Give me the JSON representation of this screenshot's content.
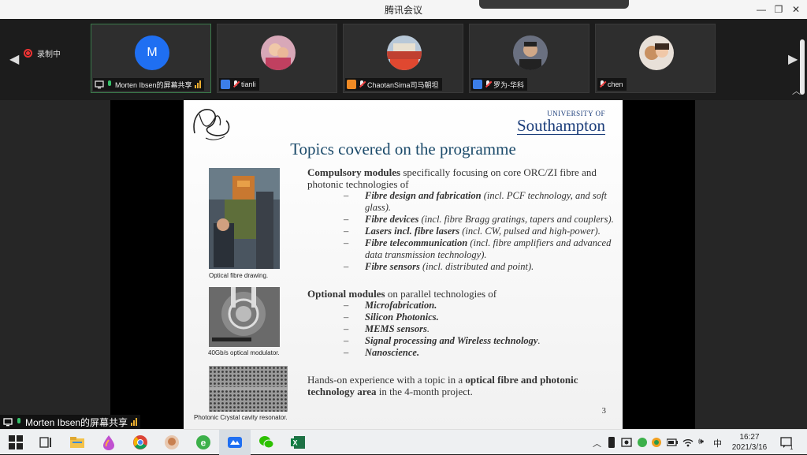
{
  "window": {
    "title": "腾讯会议"
  },
  "recording": {
    "label": "录制中"
  },
  "participants": [
    {
      "initial": "M",
      "name": "Morten Ibsen的屏幕共享",
      "active": true
    },
    {
      "name": "tianli"
    },
    {
      "name": "ChaotanSima司马朝坦"
    },
    {
      "name": "罗为-华科"
    },
    {
      "name": "chen"
    }
  ],
  "slide": {
    "university_small": "UNIVERSITY OF",
    "university_big": "Southampton",
    "title": "Topics covered on the programme",
    "captions": {
      "drawing": "Optical fibre drawing.",
      "modulator": "40Gb/s optical modulator.",
      "crystal": "Photonic Crystal cavity resonator."
    },
    "compulsory": {
      "lead_bold": "Compulsory modules",
      "lead_rest": " specifically focusing on core ORC/ZI fibre and photonic technologies of",
      "items": [
        {
          "bold": "Fibre design and fabrication",
          "rest": " (incl. PCF technology, and soft glass)."
        },
        {
          "bold": "Fibre devices",
          "rest": " (incl. fibre Bragg gratings, tapers and couplers)."
        },
        {
          "bold": "Lasers incl. fibre lasers",
          "rest": " (incl. CW, pulsed and high-power)."
        },
        {
          "bold": "Fibre telecommunication",
          "rest": " (incl. fibre amplifiers and advanced data transmission technology)."
        },
        {
          "bold": "Fibre sensors",
          "rest": " (incl. distributed and point)."
        }
      ]
    },
    "optional": {
      "lead_bold": "Optional modules",
      "lead_rest": " on parallel technologies of",
      "items": [
        {
          "bold": "Microfabrication.",
          "rest": ""
        },
        {
          "bold": "Silicon Photonics.",
          "rest": ""
        },
        {
          "bold": "MEMS sensors",
          "rest": "."
        },
        {
          "bold": "Signal processing and Wireless technology",
          "rest": "."
        },
        {
          "bold": "Nanoscience.",
          "rest": ""
        }
      ]
    },
    "handson": {
      "pre": "Hands-on experience with a topic in a ",
      "bold1": "optical fibre and photonic technology area",
      "post": " in the 4-month project."
    },
    "page_number": "3"
  },
  "share_pill": {
    "label": "Morten Ibsen的屏幕共享"
  },
  "taskbar": {
    "ime": "中",
    "time": "16:27",
    "date": "2021/3/16",
    "notification_count": "1"
  },
  "colors": {
    "accent": "#1f6ff2",
    "slide_title": "#1b4a6a",
    "university": "#1b3d7a"
  }
}
